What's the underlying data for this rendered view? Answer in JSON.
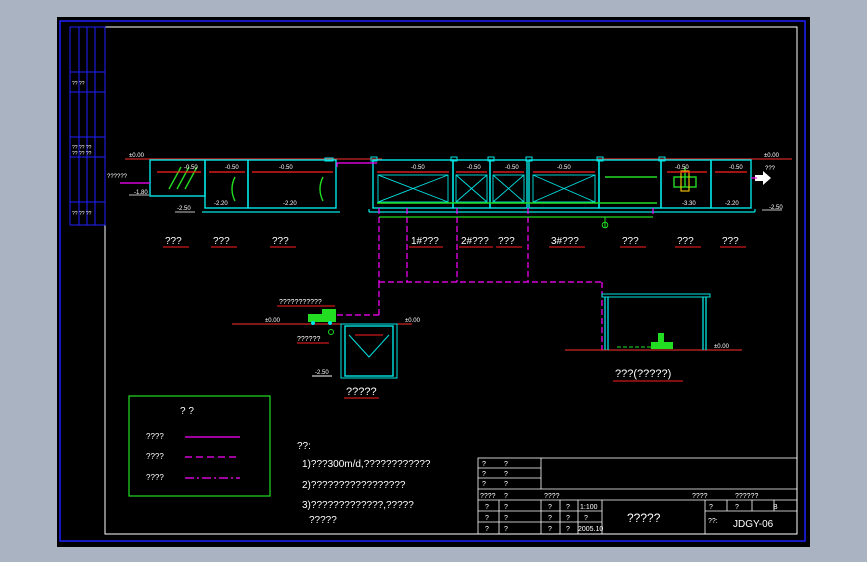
{
  "colors": {
    "background": "#000000",
    "frame": "#2020ff",
    "tank": "#00e5e5",
    "water_line": "#ff2020",
    "pipe_magenta": "#ff00ff",
    "green": "#22dd22",
    "text": "#ffffff",
    "label_red": "#ff2020",
    "outer": "#a9b3c2"
  },
  "side_strip": {
    "row_a": "?? ??",
    "row_b": "?? ?? ??",
    "row_c": "?? ?? ??",
    "row_d": "?? ?? ??"
  },
  "elevations": {
    "left_top": "±0.00",
    "left_inflow": "??????",
    "left_bottom": "-1.80",
    "left_base": "-2.50",
    "right_top": "±0.00",
    "right_out": "???",
    "right_base": "-2.50",
    "wl1": "-0.50",
    "wl2": "-0.50",
    "wl3": "-0.50",
    "wl4": "-0.50",
    "wl5": "-0.50",
    "wl6": "-0.50",
    "wl7": "-0.50",
    "wl8": "-0.50",
    "wl9": "-0.50",
    "bot1": "-2.20",
    "bot2": "-2.20",
    "bot3": "-3.30",
    "bot4": "-2.20"
  },
  "units": {
    "u1": "???",
    "u2": "???",
    "u3": "???",
    "u4": "1#???",
    "u5": "2#???",
    "u6": "???",
    "u7": "3#???",
    "u8": "???",
    "u9": "???",
    "u10": "???"
  },
  "sludge": {
    "truck_label": "???????????",
    "ground_left": "±0.00",
    "ground_right": "±0.00",
    "pump_label": "??????",
    "bottom": "-2.50",
    "name": "?????"
  },
  "equipment_room": {
    "ground": "±0.00",
    "name": "???(?????)"
  },
  "legend": {
    "title": "? ?",
    "row1": "????",
    "row2": "????",
    "row3": "????"
  },
  "notes": {
    "heading": "??:",
    "line1": "1)???300m/d,????????????",
    "line2": "2)?????????????????",
    "line3a": "3)?????????????,?????",
    "line3b": "?????"
  },
  "title_block": {
    "r1a": "?",
    "r1b": "?",
    "r2a": "?",
    "r2b": "?",
    "r3a": "?",
    "r3b": "?",
    "r4a": "????",
    "r4b": "?",
    "r4c": "????",
    "r4d": "????",
    "r4e": "??????",
    "r5a": "?",
    "r5b": "?",
    "r5c": "?",
    "r5d": "?",
    "r5e": "1:100",
    "r5f": "?",
    "r5g": "?",
    "r5h": "B",
    "r6a": "?",
    "r6b": "?",
    "r6c": "?",
    "r6d": "?",
    "r6e": "?",
    "r6f": "??:",
    "r7a": "?",
    "r7b": "?",
    "r7c": "?",
    "r7d": "?",
    "r7e": "2005.10",
    "title": "?????",
    "drawing_no": "JDGY-06"
  }
}
